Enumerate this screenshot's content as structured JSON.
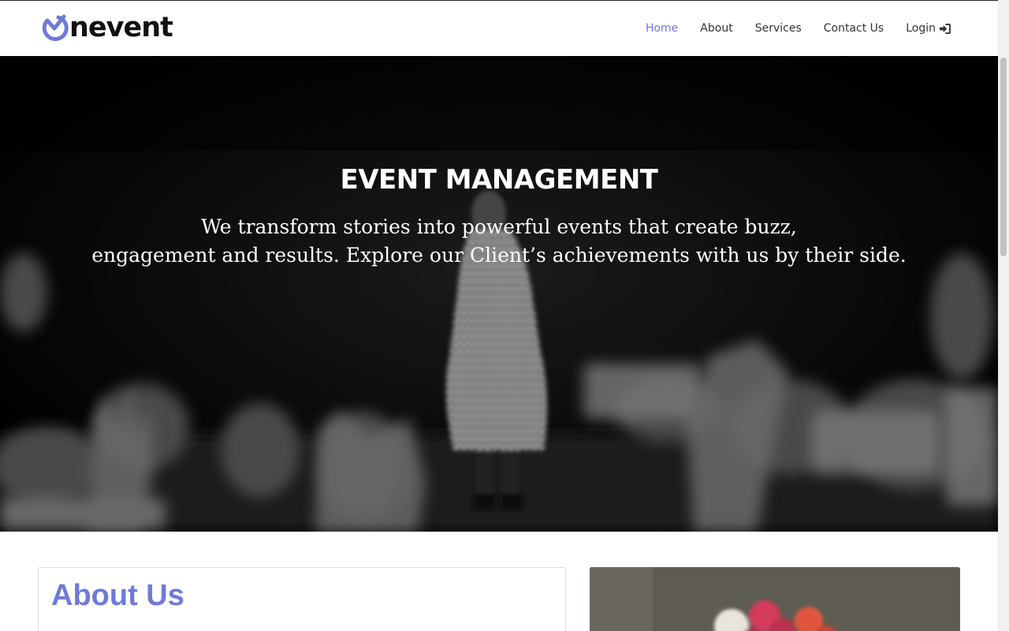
{
  "brand": {
    "name": "nevent",
    "accent_color": "#6f7ad8"
  },
  "nav": {
    "items": [
      {
        "label": "Home",
        "active": true
      },
      {
        "label": "About",
        "active": false
      },
      {
        "label": "Services",
        "active": false
      },
      {
        "label": "Contact Us",
        "active": false
      },
      {
        "label": "Login",
        "active": false,
        "icon": "sign-in-icon"
      }
    ]
  },
  "hero": {
    "title": "EVENT MANAGEMENT",
    "subtitle_line1": "We transform stories into powerful events that create buzz,",
    "subtitle_line2": "engagement and results. Explore our Client’s achievements with us by their side."
  },
  "about": {
    "title": "About Us"
  }
}
